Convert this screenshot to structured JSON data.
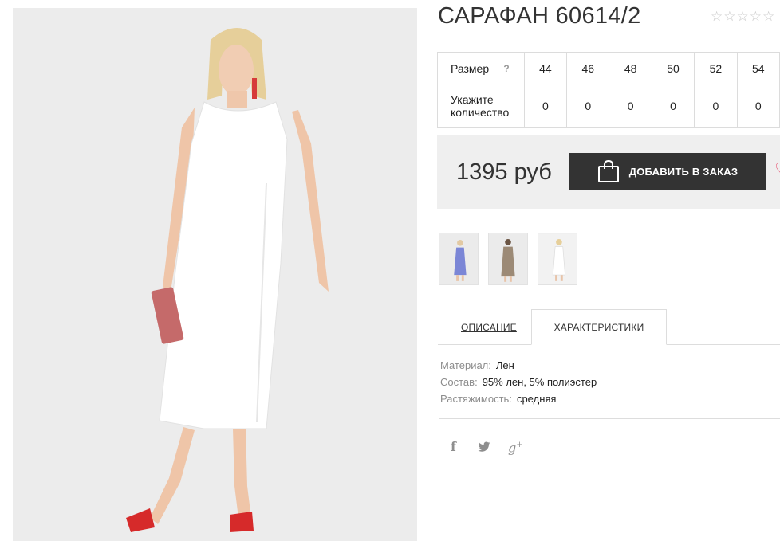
{
  "product": {
    "title": "САРАФАН 60614/2",
    "rating_stars": [
      "☆",
      "☆",
      "☆",
      "☆",
      "☆"
    ]
  },
  "size_table": {
    "size_label": "Размер",
    "help_mark": "?",
    "sizes": [
      "44",
      "46",
      "48",
      "50",
      "52",
      "54"
    ],
    "quantity_label": "Укажите количество",
    "quantities": [
      "0",
      "0",
      "0",
      "0",
      "0",
      "0"
    ]
  },
  "purchase": {
    "price": "1395 руб",
    "order_button_label": "ДОБАВИТЬ В ЗАКАЗ",
    "wishlist_glyph": "♡",
    "button_color": "#333333",
    "accent_color": "#e84c6c"
  },
  "thumbnails": [
    {
      "icon": "dress-blue-thumbnail",
      "color": "#7b86d6"
    },
    {
      "icon": "dress-beige-thumbnail",
      "color": "#9c8a76"
    },
    {
      "icon": "dress-white-thumbnail",
      "color": "#f4f4f4"
    }
  ],
  "tabs": {
    "description": "ОПИСАНИЕ",
    "characteristics": "ХАРАКТЕРИСТИКИ"
  },
  "characteristics": [
    {
      "key": "Материал:",
      "value": "Лен"
    },
    {
      "key": "Состав:",
      "value": "95% лен, 5% полиэстер"
    },
    {
      "key": "Растяжимость:",
      "value": "средняя"
    }
  ],
  "social": {
    "facebook": "f",
    "twitter": "🐦",
    "google_plus": "g"
  }
}
